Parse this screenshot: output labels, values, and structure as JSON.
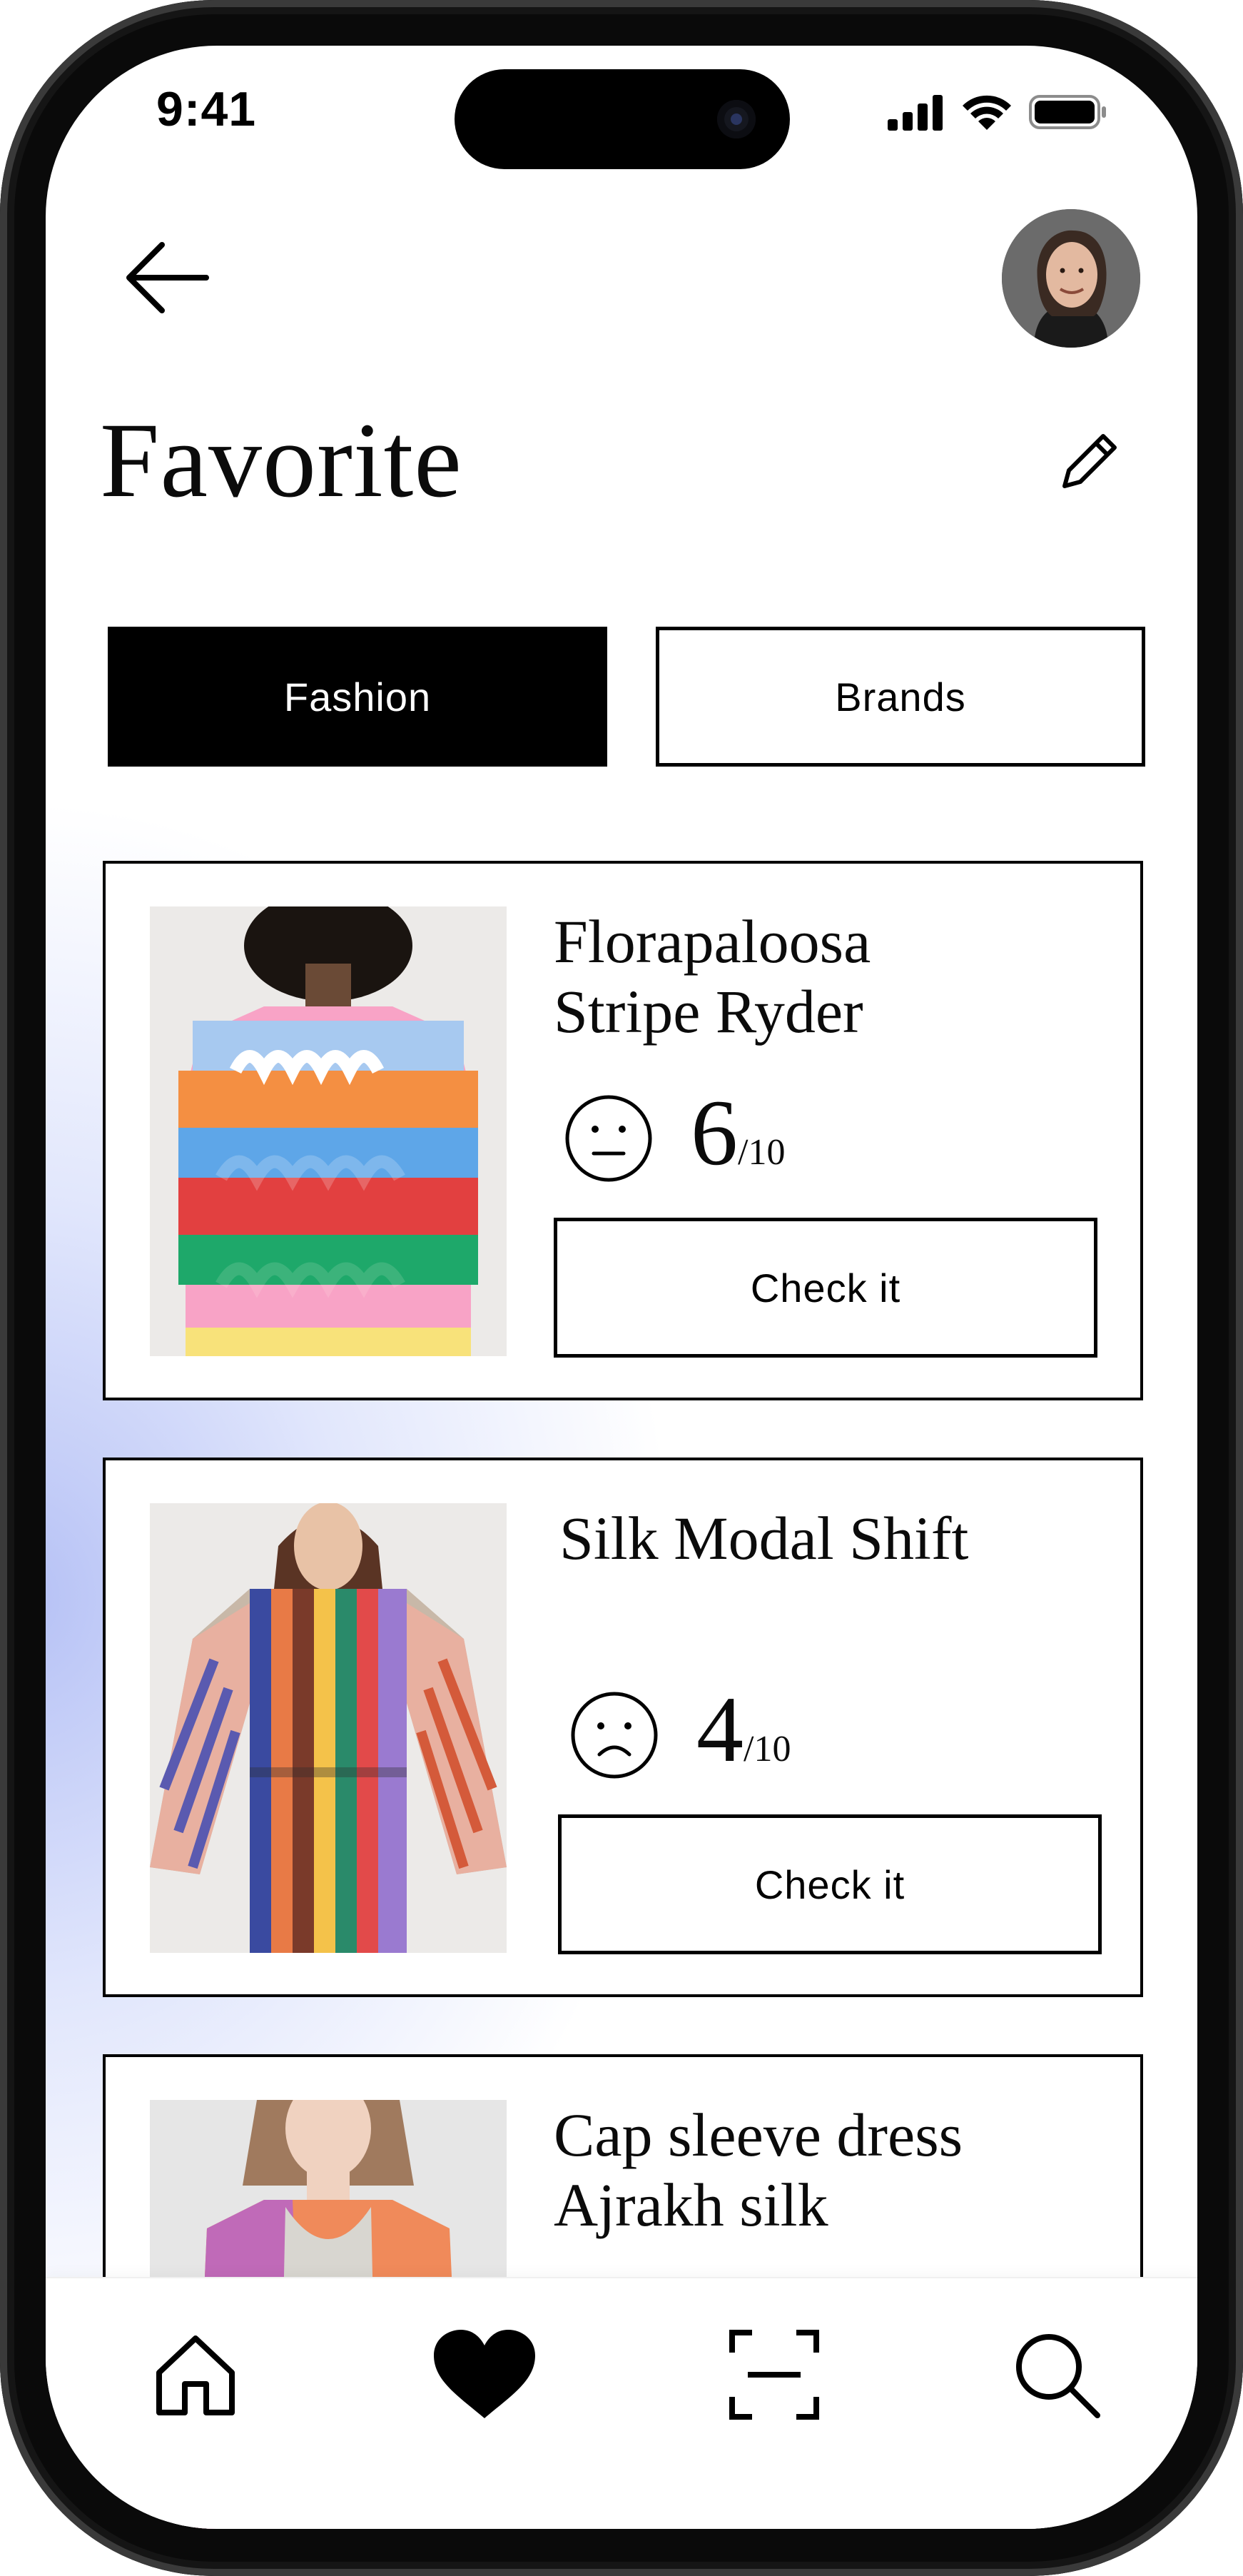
{
  "status_bar": {
    "time": "9:41"
  },
  "page": {
    "title": "Favorite"
  },
  "tabs": [
    {
      "label": "Fashion",
      "active": true
    },
    {
      "label": "Brands",
      "active": false
    }
  ],
  "products": [
    {
      "name": "Florapaloosa\nStripe Ryder",
      "score": "6",
      "scale": "/10",
      "mood_icon": "neutral-face-icon",
      "button": "Check it"
    },
    {
      "name": "Silk Modal Shift",
      "score": "4",
      "scale": "/10",
      "mood_icon": "sad-face-icon",
      "button": "Check it"
    },
    {
      "name": "Cap sleeve dress\nAjrakh silk"
    }
  ],
  "nav": [
    {
      "icon": "home-icon"
    },
    {
      "icon": "heart-icon",
      "active": true
    },
    {
      "icon": "scan-icon"
    },
    {
      "icon": "search-icon"
    }
  ],
  "colors": {
    "accent": "#000000",
    "background": "#ffffff",
    "glow": "#c7d0f8"
  }
}
